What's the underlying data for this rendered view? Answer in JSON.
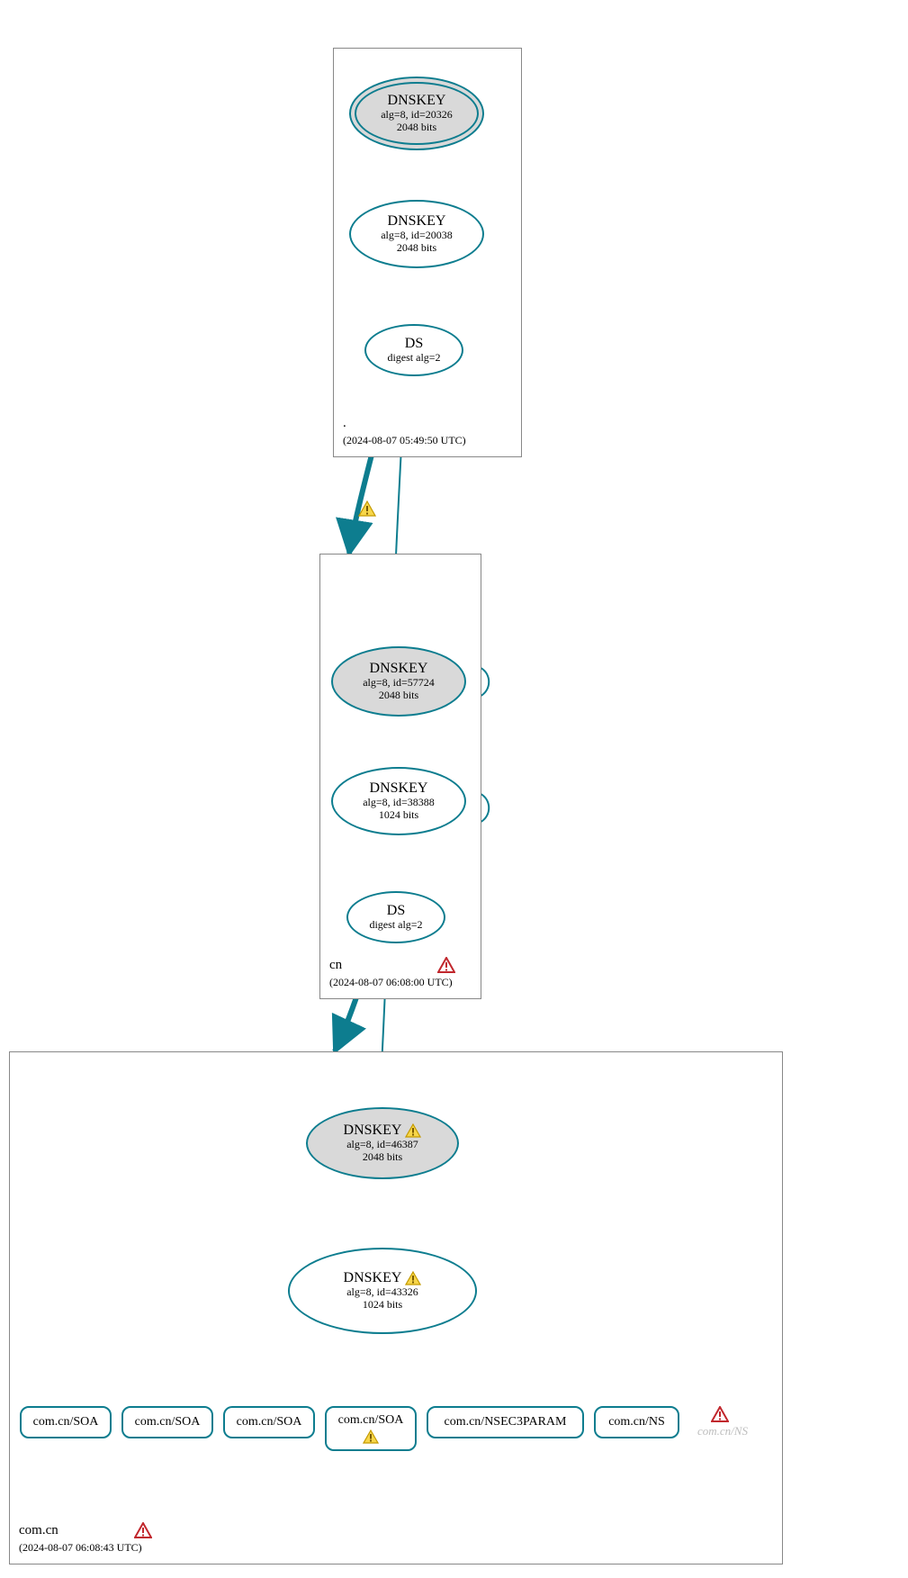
{
  "diagram": {
    "colors": {
      "stroke": "#0d7d8f",
      "fill_sep": "#d9d9d9",
      "ghost": "#bdbdbd",
      "err": "#c1272d",
      "warn_fill": "#f7d64a",
      "warn_stroke": "#c49a00"
    }
  },
  "zones": {
    "root": {
      "label": ".",
      "timestamp": "(2024-08-07 05:49:50 UTC)"
    },
    "cn": {
      "label": "cn",
      "timestamp": "(2024-08-07 06:08:00 UTC)"
    },
    "comcn": {
      "label": "com.cn",
      "timestamp": "(2024-08-07 06:08:43 UTC)"
    }
  },
  "nodes": {
    "root_ksk": {
      "title": "DNSKEY",
      "line1": "alg=8, id=20326",
      "line2": "2048 bits"
    },
    "root_zsk": {
      "title": "DNSKEY",
      "line1": "alg=8, id=20038",
      "line2": "2048 bits"
    },
    "root_ds": {
      "title": "DS",
      "line1": "digest alg=2"
    },
    "cn_ksk": {
      "title": "DNSKEY",
      "line1": "alg=8, id=57724",
      "line2": "2048 bits"
    },
    "cn_zsk": {
      "title": "DNSKEY",
      "line1": "alg=8, id=38388",
      "line2": "1024 bits"
    },
    "cn_ds": {
      "title": "DS",
      "line1": "digest alg=2"
    },
    "comcn_ksk": {
      "title": "DNSKEY",
      "line1": "alg=8, id=46387",
      "line2": "2048 bits"
    },
    "comcn_zsk": {
      "title": "DNSKEY",
      "line1": "alg=8, id=43326",
      "line2": "1024 bits"
    },
    "rr1": {
      "label": "com.cn/SOA"
    },
    "rr2": {
      "label": "com.cn/SOA"
    },
    "rr3": {
      "label": "com.cn/SOA"
    },
    "rr4": {
      "label": "com.cn/SOA"
    },
    "rr5": {
      "label": "com.cn/NSEC3PARAM"
    },
    "rr6": {
      "label": "com.cn/NS"
    }
  },
  "ghost": {
    "ns": "com.cn/NS"
  }
}
